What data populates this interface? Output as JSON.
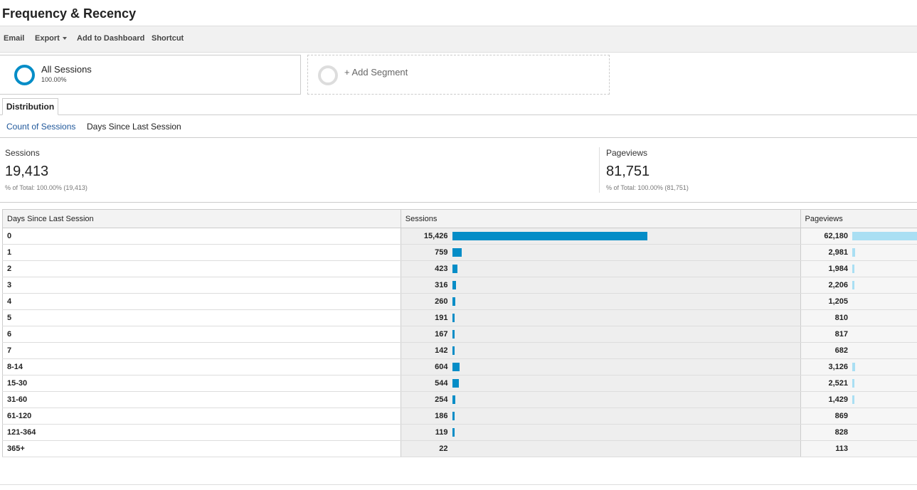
{
  "page": {
    "title": "Frequency & Recency"
  },
  "toolbar": {
    "email": "Email",
    "export": "Export",
    "add_to_dashboard": "Add to Dashboard",
    "shortcut": "Shortcut"
  },
  "segments": {
    "active": {
      "name": "All Sessions",
      "percent": "100.00%"
    },
    "add_label": "+ Add Segment"
  },
  "tabs": {
    "distribution": "Distribution"
  },
  "subnav": {
    "count_of_sessions": "Count of Sessions",
    "days_since_last_session": "Days Since Last Session"
  },
  "summary": {
    "sessions": {
      "label": "Sessions",
      "value": "19,413",
      "pct": "% of Total: 100.00% (19,413)"
    },
    "pageviews": {
      "label": "Pageviews",
      "value": "81,751",
      "pct": "% of Total: 100.00% (81,751)"
    }
  },
  "table": {
    "headers": {
      "dimension": "Days Since Last Session",
      "sessions": "Sessions",
      "pageviews": "Pageviews"
    },
    "colors": {
      "sessions_bar": "#058dc7",
      "pageviews_bar": "#aadff3"
    },
    "rows": [
      {
        "dim": "0",
        "sessions": "15,426",
        "pageviews": "62,180"
      },
      {
        "dim": "1",
        "sessions": "759",
        "pageviews": "2,981"
      },
      {
        "dim": "2",
        "sessions": "423",
        "pageviews": "1,984"
      },
      {
        "dim": "3",
        "sessions": "316",
        "pageviews": "2,206"
      },
      {
        "dim": "4",
        "sessions": "260",
        "pageviews": "1,205"
      },
      {
        "dim": "5",
        "sessions": "191",
        "pageviews": "810"
      },
      {
        "dim": "6",
        "sessions": "167",
        "pageviews": "817"
      },
      {
        "dim": "7",
        "sessions": "142",
        "pageviews": "682"
      },
      {
        "dim": "8-14",
        "sessions": "604",
        "pageviews": "3,126"
      },
      {
        "dim": "15-30",
        "sessions": "544",
        "pageviews": "2,521"
      },
      {
        "dim": "31-60",
        "sessions": "254",
        "pageviews": "1,429"
      },
      {
        "dim": "61-120",
        "sessions": "186",
        "pageviews": "869"
      },
      {
        "dim": "121-364",
        "sessions": "119",
        "pageviews": "828"
      },
      {
        "dim": "365+",
        "sessions": "22",
        "pageviews": "113"
      }
    ]
  }
}
